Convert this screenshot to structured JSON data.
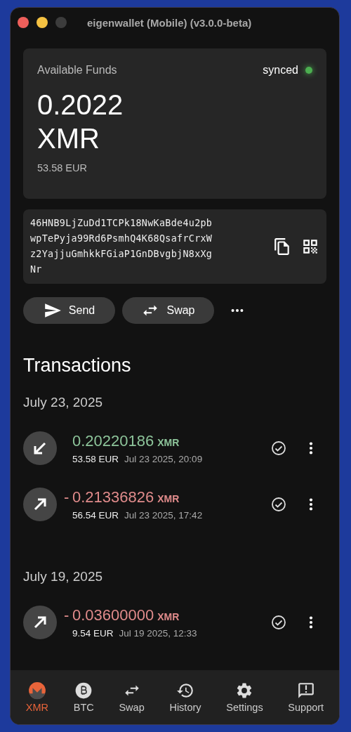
{
  "window": {
    "title": "eigenwallet (Mobile) (v3.0.0-beta)"
  },
  "balance": {
    "label": "Available Funds",
    "sync_status": "synced",
    "synced": true,
    "amount": "0.2022",
    "unit": "XMR",
    "fiat": "53.58 EUR"
  },
  "address": {
    "lines": [
      "46HNB9LjZuDd1TCPk18NwKaBde4u2pb",
      "wpTePyja99Rd6PsmhQ4K68QsafrCrxW",
      "z2YajjuGmhkkFGiaP1GnDBvgbjN8xXg",
      "Nr"
    ]
  },
  "actions": [
    {
      "label": "Send",
      "kind": "send"
    },
    {
      "label": "Swap",
      "kind": "swap"
    }
  ],
  "transactions_title": "Transactions",
  "groups": [
    {
      "date": "July 23, 2025",
      "items": [
        {
          "kind": "in",
          "amount": "0.20220186",
          "unit": "XMR",
          "fiat": "53.58 EUR",
          "time": "Jul 23 2025, 20:09"
        },
        {
          "kind": "out",
          "sign": "-",
          "amount": "0.21336826",
          "unit": "XMR",
          "fiat": "56.54 EUR",
          "time": "Jul 23 2025, 17:42"
        }
      ]
    },
    {
      "date": "July 19, 2025",
      "items": [
        {
          "kind": "out",
          "sign": "-",
          "amount": "0.03600000",
          "unit": "XMR",
          "fiat": "9.54 EUR",
          "time": "Jul 19 2025, 12:33"
        }
      ]
    }
  ],
  "nav": [
    {
      "label": "XMR",
      "kind": "xmr",
      "selected": true
    },
    {
      "label": "BTC",
      "kind": "btc",
      "selected": false
    },
    {
      "label": "Swap",
      "kind": "swap",
      "selected": false
    },
    {
      "label": "History",
      "kind": "history",
      "selected": false
    },
    {
      "label": "Settings",
      "kind": "settings",
      "selected": false
    },
    {
      "label": "Support",
      "kind": "support",
      "selected": false
    }
  ]
}
